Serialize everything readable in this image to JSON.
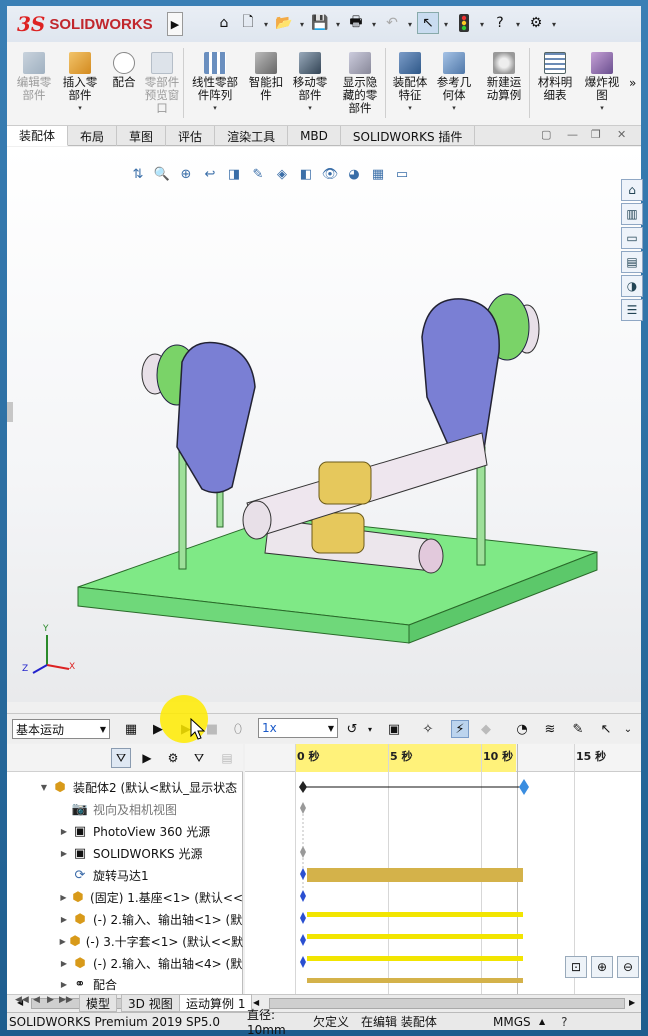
{
  "app": {
    "brand": "SOLIDWORKS",
    "brand_mark": "3S"
  },
  "ribbon": {
    "buttons": [
      {
        "label": "编辑零\n部件",
        "disabled": true
      },
      {
        "label": "插入零\n部件",
        "disabled": false
      },
      {
        "label": "配合",
        "disabled": false
      },
      {
        "label": "零部件\n预览窗\n口",
        "disabled": true
      },
      {
        "label": "线性零部\n件阵列",
        "disabled": false
      },
      {
        "label": "智能扣\n件",
        "disabled": false
      },
      {
        "label": "移动零\n部件",
        "disabled": false
      },
      {
        "label": "显示隐\n藏的零\n部件",
        "disabled": false
      },
      {
        "label": "装配体\n特征",
        "disabled": false
      },
      {
        "label": "参考几\n何体",
        "disabled": false
      },
      {
        "label": "新建运\n动算例",
        "disabled": false
      },
      {
        "label": "材料明\n细表",
        "disabled": false
      },
      {
        "label": "爆炸视\n图",
        "disabled": false
      }
    ],
    "overflow": "»"
  },
  "tabs": [
    "装配体",
    "布局",
    "草图",
    "评估",
    "渲染工具",
    "MBD",
    "SOLIDWORKS 插件"
  ],
  "axes": {
    "x": "X",
    "y": "Y",
    "z": "Z"
  },
  "motion": {
    "study_type": "基本运动",
    "speed": "1x"
  },
  "timeline": {
    "ticks": [
      "0 秒",
      "5 秒",
      "10 秒",
      "15 秒"
    ]
  },
  "tree": {
    "items": [
      {
        "label": "装配体2 (默认<默认_显示状态",
        "dim": false
      },
      {
        "label": "视向及相机视图",
        "dim": true
      },
      {
        "label": "PhotoView 360 光源",
        "dim": false
      },
      {
        "label": "SOLIDWORKS 光源",
        "dim": false
      },
      {
        "label": "旋转马达1",
        "dim": false
      },
      {
        "label": "(固定) 1.基座<1> (默认<<",
        "dim": false
      },
      {
        "label": "(-) 2.输入、输出轴<1> (默",
        "dim": false
      },
      {
        "label": "(-) 3.十字套<1> (默认<<默",
        "dim": false
      },
      {
        "label": "(-) 2.输入、输出轴<4> (默",
        "dim": false
      },
      {
        "label": "配合",
        "dim": false
      }
    ]
  },
  "sheet_tabs": [
    "模型",
    "3D 视图",
    "运动算例 1"
  ],
  "status": {
    "product": "SOLIDWORKS Premium 2019 SP5.0",
    "diameter": "直径: 10mm",
    "defined": "欠定义",
    "editing": "在编辑 装配体",
    "units": "MMGS"
  }
}
